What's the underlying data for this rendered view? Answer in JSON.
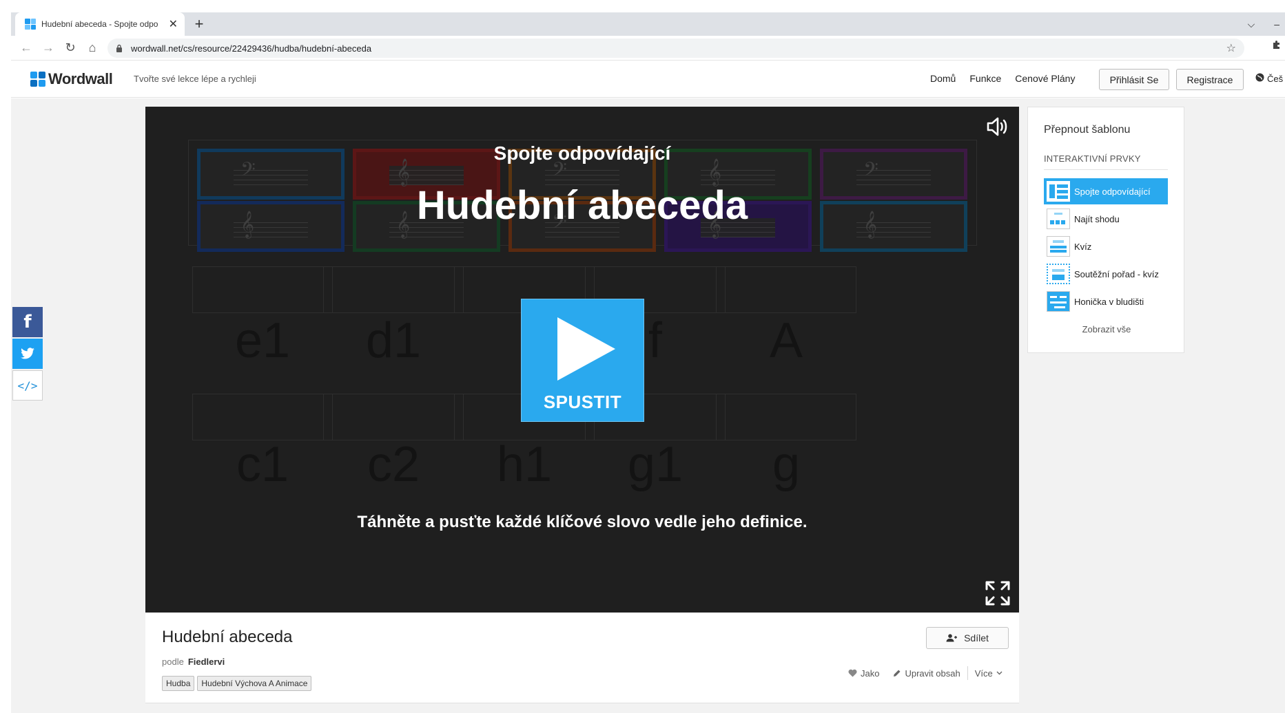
{
  "browser": {
    "tab_title": "Hudební abeceda - Spojte odpo",
    "tab_close": "✕",
    "new_tab": "+",
    "url": "wordwall.net/cs/resource/22429436/hudba/hudební-abeceda",
    "win_min": "–",
    "win_chevron": "⌵"
  },
  "site": {
    "logo_text": "Wordwall",
    "tagline": "Tvořte své lekce lépe a rychleji",
    "nav": [
      "Domů",
      "Funkce",
      "Cenové Plány"
    ],
    "login_label": "Přihlásit Se",
    "register_label": "Registrace",
    "language": "Češ"
  },
  "game": {
    "subtitle": "Spojte odpovídající",
    "title": "Hudební abeceda",
    "play_label": "SPUSTIT",
    "instructions": "Táhněte a pusťte každé klíčové slovo vedle jeho definice.",
    "row1_words": [
      "e1",
      "d1",
      "",
      "f",
      "A"
    ],
    "row2_words": [
      "c1",
      "c2",
      "h1",
      "g1",
      "g"
    ]
  },
  "activity": {
    "title": "Hudební abeceda",
    "by_label": "podle",
    "author": "Fiedlervi",
    "tags": [
      "Hudba",
      "Hudební Výchova A Animace"
    ],
    "share_label": "Sdílet",
    "like_label": "Jako",
    "edit_label": "Upravit obsah",
    "more_label": "Více"
  },
  "templates": {
    "heading": "Přepnout šablonu",
    "section": "INTERAKTIVNÍ PRVKY",
    "items": [
      {
        "label": "Spojte odpovídající",
        "icon": "match-up-icon"
      },
      {
        "label": "Najít shodu",
        "icon": "find-match-icon"
      },
      {
        "label": "Kvíz",
        "icon": "quiz-icon"
      },
      {
        "label": "Soutěžní pořad - kvíz",
        "icon": "gameshow-quiz-icon"
      },
      {
        "label": "Honička v bludišti",
        "icon": "maze-chase-icon"
      }
    ],
    "show_all": "Zobrazit vše"
  },
  "colors": {
    "accent": "#2aa9ee",
    "facebook": "#3b5998",
    "twitter": "#1da1f2",
    "tile_borders": [
      "#103a5c",
      "#5c1616",
      "#5a3410",
      "#163f1f",
      "#3d1a44",
      "#132a5a",
      "#143b22",
      "#5a2a10",
      "#2b1655",
      "#10405a"
    ]
  }
}
